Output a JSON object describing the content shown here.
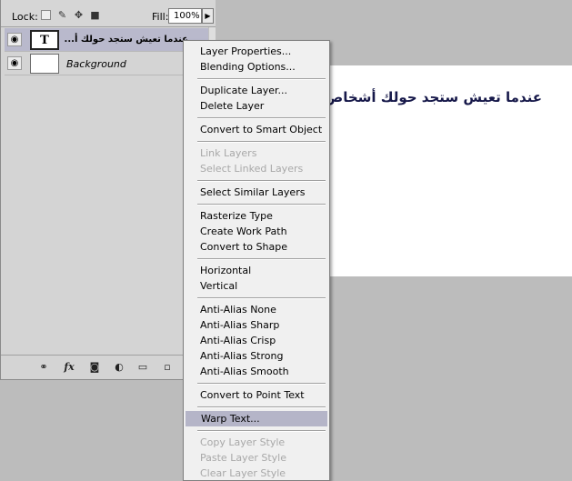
{
  "lock_bar": {
    "lock_label": "Lock:",
    "fill_label": "Fill:",
    "fill_value": "100%"
  },
  "layers": [
    {
      "name": "عندما تعيش ستجد حولك أ...",
      "thumb": "T",
      "selected": true
    },
    {
      "name": "Background",
      "thumb": "",
      "selected": false
    }
  ],
  "canvas": {
    "text": "عندما تعيش ستجد حولك أشخاص، يكو"
  },
  "context_menu": {
    "items": [
      {
        "label": "Layer Properties...",
        "disabled": false
      },
      {
        "label": "Blending Options...",
        "disabled": false
      },
      {
        "label": "Duplicate Layer...",
        "disabled": false
      },
      {
        "label": "Delete Layer",
        "disabled": false
      },
      {
        "label": "Convert to Smart Object",
        "disabled": false
      },
      {
        "label": "Link Layers",
        "disabled": true
      },
      {
        "label": "Select Linked Layers",
        "disabled": true
      },
      {
        "label": "Select Similar Layers",
        "disabled": false
      },
      {
        "label": "Rasterize Type",
        "disabled": false
      },
      {
        "label": "Create Work Path",
        "disabled": false
      },
      {
        "label": "Convert to Shape",
        "disabled": false
      },
      {
        "label": "Horizontal",
        "disabled": false
      },
      {
        "label": "Vertical",
        "disabled": false
      },
      {
        "label": "Anti-Alias None",
        "disabled": false
      },
      {
        "label": "Anti-Alias Sharp",
        "disabled": false
      },
      {
        "label": "Anti-Alias Crisp",
        "disabled": false
      },
      {
        "label": "Anti-Alias Strong",
        "disabled": false
      },
      {
        "label": "Anti-Alias Smooth",
        "disabled": false
      },
      {
        "label": "Convert to Point Text",
        "disabled": false
      },
      {
        "label": "Warp Text...",
        "disabled": false,
        "highlighted": true
      },
      {
        "label": "Copy Layer Style",
        "disabled": true
      },
      {
        "label": "Paste Layer Style",
        "disabled": true
      },
      {
        "label": "Clear Layer Style",
        "disabled": true
      }
    ]
  },
  "icons": {
    "eye": "eye-icon",
    "lock_transparent": "lock-transparent-pixels-icon",
    "lock_image": "lock-image-pixels-icon",
    "lock_position": "lock-position-icon",
    "lock_all": "lock-all-icon",
    "link": "link-layers-icon",
    "fx": "layer-style-icon",
    "mask": "layer-mask-icon",
    "adjustment": "adjustment-layer-icon",
    "group": "new-group-icon",
    "new_layer": "new-layer-icon"
  },
  "colors": {
    "menu_highlight": "#b5b5c8",
    "selected_layer": "#b9b9cc",
    "canvas_text": "#17194a"
  }
}
